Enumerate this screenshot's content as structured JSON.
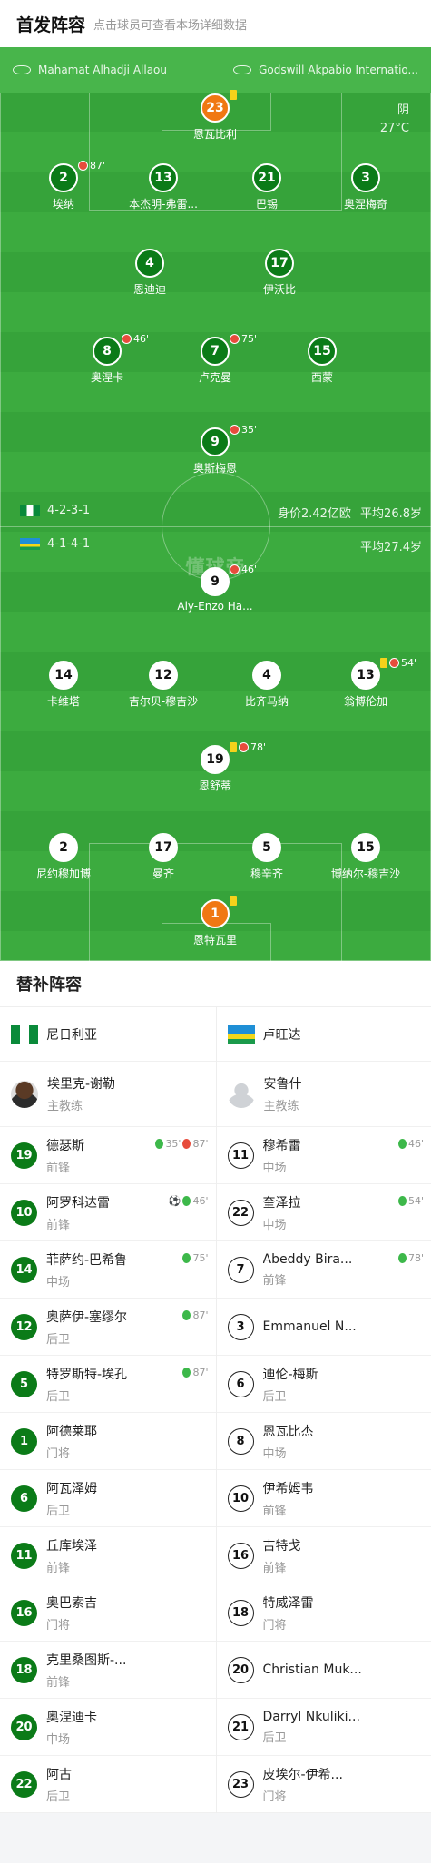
{
  "header": {
    "title": "首发阵容",
    "subtitle": "点击球员可查看本场详细数据"
  },
  "pitch": {
    "referee": "Mahamat Alhadji Allaou",
    "stadium": "Godswill Akpabio Internatio...",
    "weather": "阴",
    "temperature": "27°C",
    "watermark": "懂球帝",
    "home": {
      "formation": "4-2-3-1",
      "value": "身价2.42亿欧",
      "age": "平均26.8岁"
    },
    "away": {
      "formation": "4-1-4-1",
      "age": "平均27.4岁"
    }
  },
  "home_players": [
    {
      "num": "23",
      "name": "恩瓦比利",
      "gk": true,
      "yellow": true
    },
    {
      "num": "2",
      "name": "埃纳",
      "sub": "87'"
    },
    {
      "num": "13",
      "name": "本杰明-弗雷..."
    },
    {
      "num": "21",
      "name": "巴锡"
    },
    {
      "num": "3",
      "name": "奥涅梅奇"
    },
    {
      "num": "4",
      "name": "恩迪迪",
      "captain": "C"
    },
    {
      "num": "17",
      "name": "伊沃比"
    },
    {
      "num": "8",
      "name": "奥涅卡",
      "sub": "46'"
    },
    {
      "num": "7",
      "name": "卢克曼",
      "sub": "75'"
    },
    {
      "num": "15",
      "name": "西蒙"
    },
    {
      "num": "9",
      "name": "奥斯梅恩",
      "sub": "35'"
    }
  ],
  "away_players": [
    {
      "num": "9",
      "name": "Aly-Enzo Ha...",
      "sub": "46'"
    },
    {
      "num": "14",
      "name": "卡维塔"
    },
    {
      "num": "12",
      "name": "吉尔贝-穆吉沙"
    },
    {
      "num": "4",
      "name": "比齐马纳",
      "captain": "C"
    },
    {
      "num": "13",
      "name": "翁博伦加",
      "yellow": true,
      "sub": "54'"
    },
    {
      "num": "19",
      "name": "恩舒蒂",
      "yellow": true,
      "sub": "78'"
    },
    {
      "num": "2",
      "name": "尼约穆加博"
    },
    {
      "num": "17",
      "name": "曼齐"
    },
    {
      "num": "5",
      "name": "穆辛齐"
    },
    {
      "num": "15",
      "name": "博纳尔-穆吉沙"
    },
    {
      "num": "1",
      "name": "恩特瓦里",
      "gk": true,
      "yellow": true
    }
  ],
  "subs": {
    "title": "替补阵容",
    "home": {
      "team": "尼日利亚",
      "coach": {
        "name": "埃里克-谢勒",
        "role": "主教练"
      },
      "players": [
        {
          "num": "19",
          "name": "德瑟斯",
          "pos": "前锋",
          "ev": [
            "35'",
            "87'"
          ],
          "evt": [
            "in",
            "out"
          ]
        },
        {
          "num": "10",
          "name": "阿罗科达雷",
          "pos": "前锋",
          "ev": [
            "46'"
          ],
          "evt": [
            "in"
          ],
          "goal": "⚽"
        },
        {
          "num": "14",
          "name": "菲萨约-巴希鲁",
          "pos": "中场",
          "ev": [
            "75'"
          ],
          "evt": [
            "in"
          ]
        },
        {
          "num": "12",
          "name": "奥萨伊-塞缪尔",
          "pos": "后卫",
          "ev": [
            "87'"
          ],
          "evt": [
            "in"
          ]
        },
        {
          "num": "5",
          "name": "特罗斯特-埃孔",
          "pos": "后卫",
          "ev": [
            "87'"
          ],
          "evt": [
            "in"
          ]
        },
        {
          "num": "1",
          "name": "阿德莱耶",
          "pos": "门将"
        },
        {
          "num": "6",
          "name": "阿瓦泽姆",
          "pos": "后卫"
        },
        {
          "num": "11",
          "name": "丘库埃泽",
          "pos": "前锋"
        },
        {
          "num": "16",
          "name": "奥巴索吉",
          "pos": "门将"
        },
        {
          "num": "18",
          "name": "克里桑图斯-...",
          "pos": "前锋"
        },
        {
          "num": "20",
          "name": "奥涅迪卡",
          "pos": "中场"
        },
        {
          "num": "22",
          "name": "阿古",
          "pos": "后卫"
        }
      ]
    },
    "away": {
      "team": "卢旺达",
      "coach": {
        "name": "安鲁什",
        "role": "主教练"
      },
      "players": [
        {
          "num": "11",
          "name": "穆希雷",
          "pos": "中场",
          "ev": [
            "46'"
          ],
          "evt": [
            "in"
          ]
        },
        {
          "num": "22",
          "name": "奎泽拉",
          "pos": "中场",
          "ev": [
            "54'"
          ],
          "evt": [
            "in"
          ]
        },
        {
          "num": "7",
          "name": "Abeddy Bira...",
          "pos": "前锋",
          "ev": [
            "78'"
          ],
          "evt": [
            "in"
          ]
        },
        {
          "num": "3",
          "name": "Emmanuel N...",
          "pos": ""
        },
        {
          "num": "6",
          "name": "迪伦-梅斯",
          "pos": "后卫"
        },
        {
          "num": "8",
          "name": "恩瓦比杰",
          "pos": "中场"
        },
        {
          "num": "10",
          "name": "伊希姆韦",
          "pos": "前锋"
        },
        {
          "num": "16",
          "name": "吉特戈",
          "pos": "前锋"
        },
        {
          "num": "18",
          "name": "特威泽雷",
          "pos": "门将"
        },
        {
          "num": "20",
          "name": "Christian Muk...",
          "pos": ""
        },
        {
          "num": "21",
          "name": "Darryl Nkuliki...",
          "pos": "后卫"
        },
        {
          "num": "23",
          "name": "皮埃尔-伊希...",
          "pos": "门将"
        }
      ]
    }
  }
}
